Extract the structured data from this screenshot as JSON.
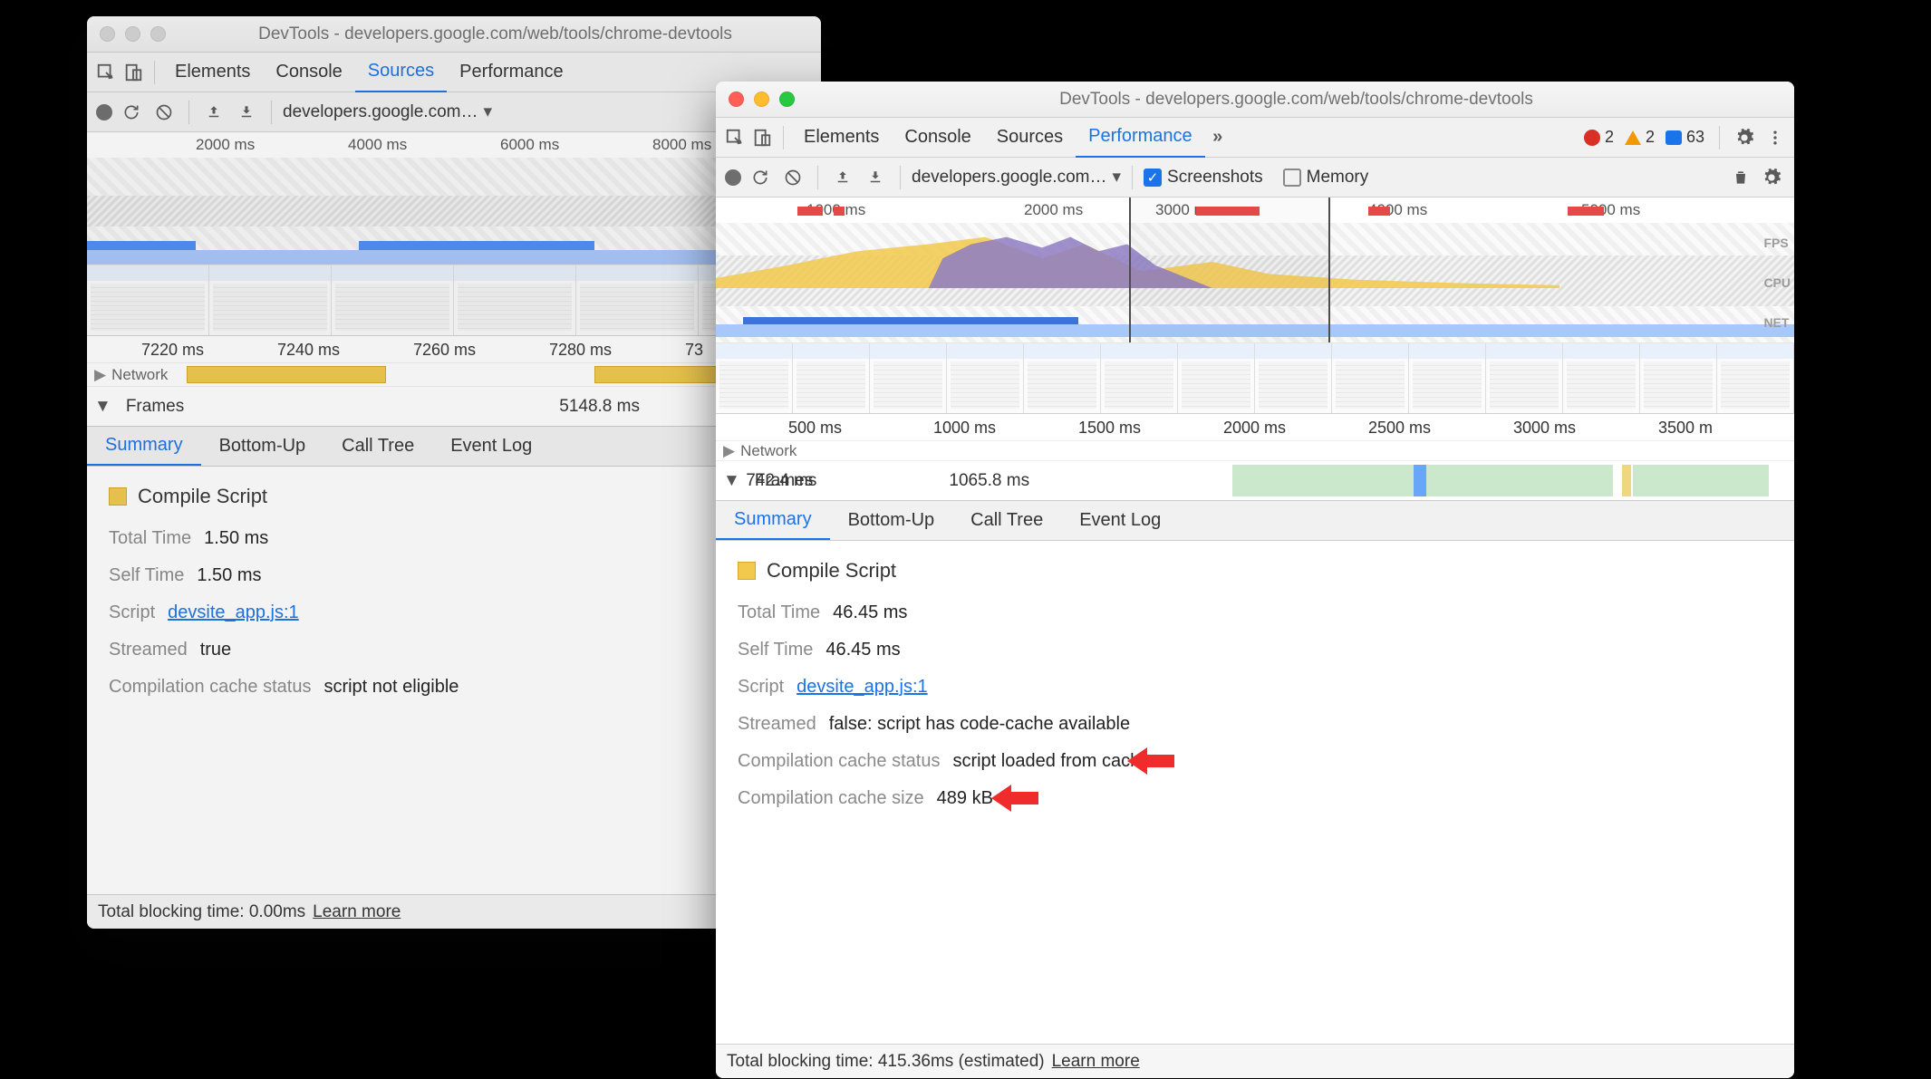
{
  "windows": {
    "left": {
      "title": "DevTools - developers.google.com/web/tools/chrome-devtools",
      "tabs": [
        "Elements",
        "Console",
        "Sources",
        "Performance"
      ],
      "active_tab": "Sources",
      "url_select": "developers.google.com…",
      "ruler_top": [
        "2000 ms",
        "4000 ms",
        "6000 ms",
        "8000 ms"
      ],
      "ruler_main": [
        "7220 ms",
        "7240 ms",
        "7260 ms",
        "7280 ms",
        "73"
      ],
      "network_label": "Network",
      "frames_label": "Frames",
      "frames_value": "5148.8 ms",
      "detail_tabs": [
        "Summary",
        "Bottom-Up",
        "Call Tree",
        "Event Log"
      ],
      "summary": {
        "title": "Compile Script",
        "rows": [
          {
            "label": "Total Time",
            "value": "1.50 ms"
          },
          {
            "label": "Self Time",
            "value": "1.50 ms"
          },
          {
            "label": "Script",
            "link": "devsite_app.js:1"
          },
          {
            "label": "Streamed",
            "value": "true"
          },
          {
            "label": "Compilation cache status",
            "value": "script not eligible",
            "arrow": true
          }
        ]
      },
      "footer": {
        "tbt": "Total blocking time: 0.00ms",
        "learn": "Learn more"
      }
    },
    "right": {
      "title": "DevTools - developers.google.com/web/tools/chrome-devtools",
      "tabs": [
        "Elements",
        "Console",
        "Sources",
        "Performance"
      ],
      "active_tab": "Performance",
      "badges": {
        "errors": "2",
        "warnings": "2",
        "messages": "63"
      },
      "toolbar": {
        "url_select": "developers.google.com…",
        "screenshots_label": "Screenshots",
        "screenshots_checked": true,
        "memory_label": "Memory",
        "memory_checked": false
      },
      "ruler_top": [
        "1000 ms",
        "2000 ms",
        "3000 ms",
        "4000 ms",
        "5000 ms"
      ],
      "overview_labels": [
        "FPS",
        "CPU",
        "NET"
      ],
      "ruler_main": [
        "500 ms",
        "1000 ms",
        "1500 ms",
        "2000 ms",
        "2500 ms",
        "3000 ms",
        "3500 m"
      ],
      "network_label": "Network",
      "frames_label": "Frames",
      "frames_values": [
        "742.4 ms",
        "1065.8 ms"
      ],
      "detail_tabs": [
        "Summary",
        "Bottom-Up",
        "Call Tree",
        "Event Log"
      ],
      "summary": {
        "title": "Compile Script",
        "rows": [
          {
            "label": "Total Time",
            "value": "46.45 ms"
          },
          {
            "label": "Self Time",
            "value": "46.45 ms"
          },
          {
            "label": "Script",
            "link": "devsite_app.js:1"
          },
          {
            "label": "Streamed",
            "value": "false: script has code-cache available"
          },
          {
            "label": "Compilation cache status",
            "value": "script loaded from cache",
            "arrow": true
          },
          {
            "label": "Compilation cache size",
            "value": "489 kB",
            "arrow": true
          }
        ]
      },
      "footer": {
        "tbt": "Total blocking time: 415.36ms (estimated)",
        "learn": "Learn more"
      }
    }
  },
  "icons": {
    "more": "»",
    "dropdown": "▾",
    "collapse": "▼",
    "check": "✓"
  }
}
